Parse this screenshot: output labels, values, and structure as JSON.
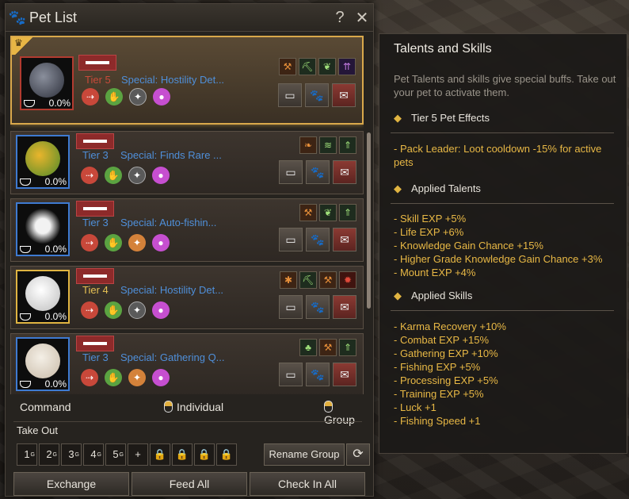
{
  "window": {
    "title": "Pet List",
    "help_icon": "?",
    "close_icon": "✕"
  },
  "pets": [
    {
      "tier": "Tier 5",
      "special": "Special: Hostility Det...",
      "hunger": "0.0%"
    },
    {
      "tier": "Tier 3",
      "special": "Special: Finds Rare ...",
      "hunger": "0.0%"
    },
    {
      "tier": "Tier 3",
      "special": "Special: Auto-fishin...",
      "hunger": "0.0%"
    },
    {
      "tier": "Tier 4",
      "special": "Special: Hostility Det...",
      "hunger": "0.0%"
    },
    {
      "tier": "Tier 3",
      "special": "Special: Gathering Q...",
      "hunger": "0.0%"
    }
  ],
  "controls": {
    "command": "Command",
    "individual": "Individual",
    "group": "Group",
    "take_out": "Take Out",
    "slots": [
      "1",
      "2",
      "3",
      "4",
      "5"
    ],
    "slot_sup": "G",
    "add": "+",
    "rename_group": "Rename Group",
    "exchange": "Exchange",
    "feed_all": "Feed All",
    "check_in_all": "Check In All"
  },
  "talents": {
    "title": "Talents and Skills",
    "intro": "Pet Talents and skills give special buffs. Take out your pet to activate them.",
    "pet_effects_title": "Tier 5 Pet Effects",
    "pet_effects": "- Pack Leader: Loot cooldown -15% for active pets",
    "applied_talents_title": "Applied Talents",
    "applied_talents": [
      "- Skill EXP +5%",
      "- Life EXP +6%",
      "- Knowledge Gain Chance +15%",
      "- Higher Grade Knowledge Gain Chance +3%",
      "- Mount EXP +4%"
    ],
    "applied_skills_title": "Applied Skills",
    "applied_skills": [
      "- Karma Recovery +10%",
      "- Combat EXP +15%",
      "- Gathering EXP +10%",
      "- Fishing EXP +5%",
      "- Processing EXP +5%",
      "- Training EXP +5%",
      "- Luck +1",
      "- Fishing Speed +1"
    ]
  },
  "colors": {
    "tier_blue": "#4f8fd9",
    "tier_gold": "#e8c254",
    "tier_red": "#c84a3a",
    "effect_text": "#e8b845",
    "leader_border": "#d9a84b"
  }
}
